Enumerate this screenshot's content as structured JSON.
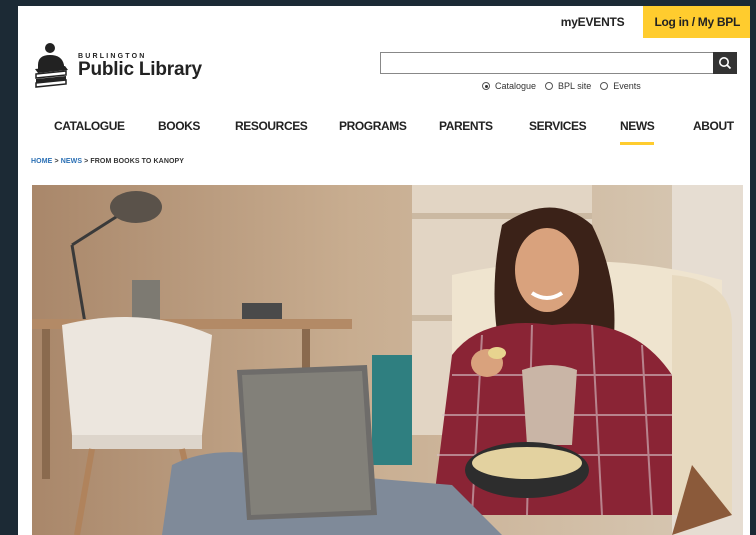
{
  "topbar": {
    "myevents": "myEVENTS",
    "login": "Log in / My BPL"
  },
  "logo": {
    "small": "BURLINGTON",
    "big": "Public Library"
  },
  "search": {
    "placeholder": "",
    "value": ""
  },
  "search_options": [
    {
      "label": "Catalogue",
      "selected": true
    },
    {
      "label": "BPL site",
      "selected": false
    },
    {
      "label": "Events",
      "selected": false
    }
  ],
  "nav": [
    "CATALOGUE",
    "BOOKS",
    "RESOURCES",
    "PROGRAMS",
    "PARENTS",
    "SERVICES",
    "NEWS",
    "ABOUT"
  ],
  "breadcrumb": {
    "home": "HOME",
    "sep1": ">",
    "news": "NEWS",
    "sep2": ">",
    "current": "FROM BOOKS TO KANOPY"
  },
  "colors": {
    "accent": "#ffcc2e",
    "link": "#2a6fb4"
  }
}
